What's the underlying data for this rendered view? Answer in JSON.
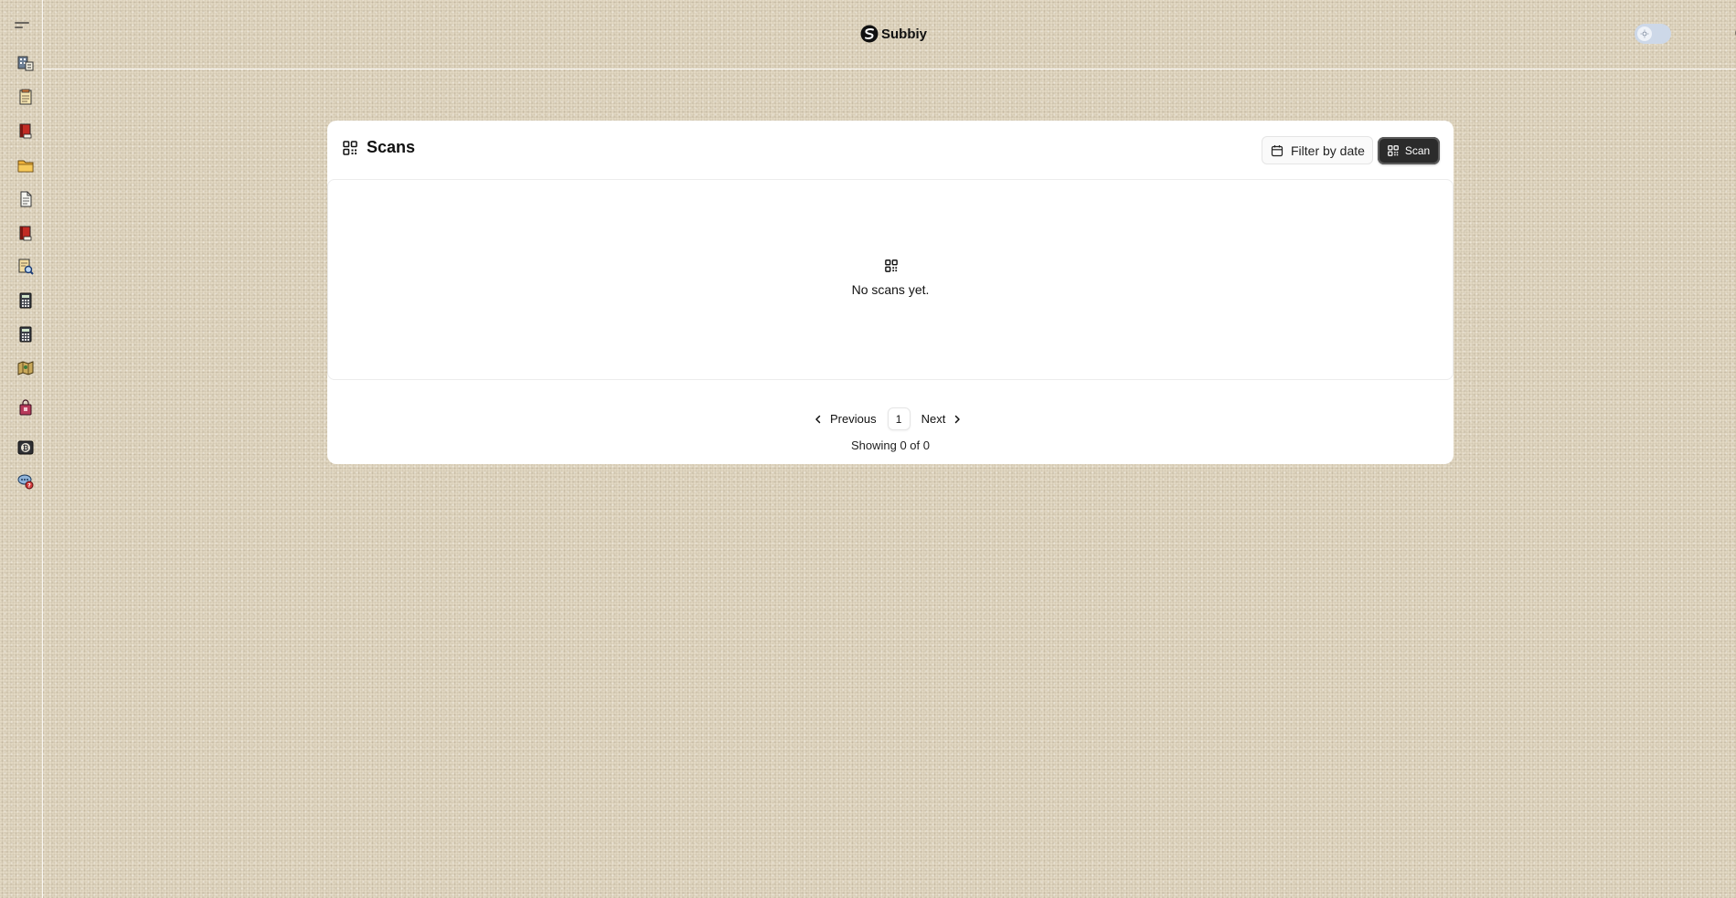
{
  "header": {
    "brand_name": "Subbiy"
  },
  "sidebar": {
    "items": [
      {
        "icon": "building-document-icon"
      },
      {
        "icon": "notepad-icon"
      },
      {
        "icon": "red-book-icon"
      },
      {
        "icon": "folder-icon"
      },
      {
        "icon": "page-icon"
      },
      {
        "icon": "red-book-icon"
      },
      {
        "icon": "document-search-icon"
      },
      {
        "icon": "calculator-icon"
      },
      {
        "icon": "calculator-icon"
      },
      {
        "icon": "map-icon"
      },
      {
        "icon": "shopping-bag-icon"
      },
      {
        "icon": "bitcoin-icon"
      },
      {
        "icon": "chat-support-icon"
      }
    ]
  },
  "page": {
    "title": "Scans",
    "filter_label": "Filter by date",
    "scan_label": "Scan",
    "empty_message": "No scans yet.",
    "pagination": {
      "previous_label": "Previous",
      "current_page": "1",
      "next_label": "Next"
    },
    "showing_text": "Showing 0 of 0"
  },
  "colors": {
    "background": "#e2d8c3",
    "card": "#ffffff",
    "primary_button": "#2b2b2b",
    "toggle": "#cdd8e8"
  }
}
